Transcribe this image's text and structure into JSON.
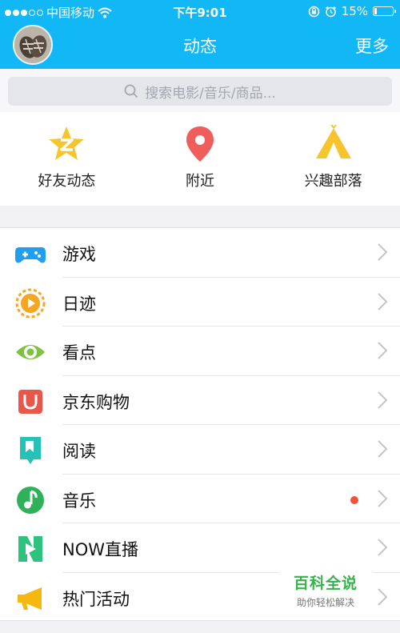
{
  "status_bar": {
    "carrier": "中国移动",
    "time": "下午9:01",
    "battery": "15%",
    "battery_level": 0.15,
    "signal_dots": [
      true,
      true,
      true,
      false,
      false
    ]
  },
  "nav": {
    "title": "动态",
    "more": "更多"
  },
  "search": {
    "placeholder": "搜索电影/音乐/商品..."
  },
  "shortcuts": [
    {
      "label": "好友动态",
      "icon": "qzone-star-icon"
    },
    {
      "label": "附近",
      "icon": "location-pin-icon"
    },
    {
      "label": "兴趣部落",
      "icon": "tent-icon"
    }
  ],
  "menu": [
    {
      "label": "游戏",
      "icon": "gamepad-icon",
      "color": "#1e9ff2"
    },
    {
      "label": "日迹",
      "icon": "play-circle-icon",
      "color": "#f5a623"
    },
    {
      "label": "看点",
      "icon": "eye-icon",
      "color": "#7fc242"
    },
    {
      "label": "京东购物",
      "icon": "jd-bag-icon",
      "color": "#e8574a"
    },
    {
      "label": "阅读",
      "icon": "bookmark-icon",
      "color": "#26c1b7"
    },
    {
      "label": "音乐",
      "icon": "music-note-icon",
      "color": "#2fb15a",
      "badge": true
    },
    {
      "label": "NOW直播",
      "icon": "now-live-icon",
      "color": "#2ec27e"
    },
    {
      "label": "热门活动",
      "icon": "megaphone-icon",
      "color": "#f5b80f"
    }
  ],
  "watermark": {
    "title": "百科全说",
    "subtitle": "助你轻松解决"
  },
  "colors": {
    "brand_blue": "#12b7f5",
    "badge_red": "#f0533a"
  }
}
